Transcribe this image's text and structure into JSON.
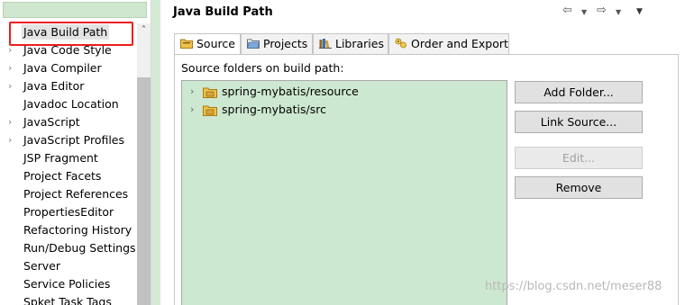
{
  "nav": {
    "items": [
      {
        "label": "Java Build Path",
        "expandable": false,
        "selected": true
      },
      {
        "label": "Java Code Style",
        "expandable": true
      },
      {
        "label": "Java Compiler",
        "expandable": true
      },
      {
        "label": "Java Editor",
        "expandable": true
      },
      {
        "label": "Javadoc Location",
        "expandable": false
      },
      {
        "label": "JavaScript",
        "expandable": true
      },
      {
        "label": "JavaScript Profiles",
        "expandable": true
      },
      {
        "label": "JSP Fragment",
        "expandable": false
      },
      {
        "label": "Project Facets",
        "expandable": false
      },
      {
        "label": "Project References",
        "expandable": false
      },
      {
        "label": "PropertiesEditor",
        "expandable": false
      },
      {
        "label": "Refactoring History",
        "expandable": false
      },
      {
        "label": "Run/Debug Settings",
        "expandable": false
      },
      {
        "label": "Server",
        "expandable": false
      },
      {
        "label": "Service Policies",
        "expandable": false
      },
      {
        "label": "Spket Task Tags",
        "expandable": false
      }
    ],
    "twisty_glyph": "›"
  },
  "pane": {
    "title": "Java Build Path",
    "history": {
      "back": "⇦",
      "forward": "⇨",
      "dropdown": "▼",
      "menu": "▼"
    }
  },
  "tabs": [
    {
      "label": "Source",
      "icon": "source-folder-icon",
      "active": true
    },
    {
      "label": "Projects",
      "icon": "projects-folder-icon",
      "active": false
    },
    {
      "label": "Libraries",
      "icon": "libraries-icon",
      "active": false
    },
    {
      "label": "Order and Export",
      "icon": "order-export-icon",
      "active": false
    }
  ],
  "source": {
    "section_label": "Source folders on build path:",
    "folders": [
      {
        "label": "spring-mybatis/resource"
      },
      {
        "label": "spring-mybatis/src"
      }
    ],
    "buttons": {
      "add_folder": "Add Folder...",
      "link_source": "Link Source...",
      "edit": "Edit...",
      "remove": "Remove"
    }
  },
  "watermark": "https://blog.csdn.net/meser88",
  "colors": {
    "selection_highlight": "#ee1c1c",
    "tree_background": "#cde8d0",
    "folder_icon": "#e8b33a"
  }
}
